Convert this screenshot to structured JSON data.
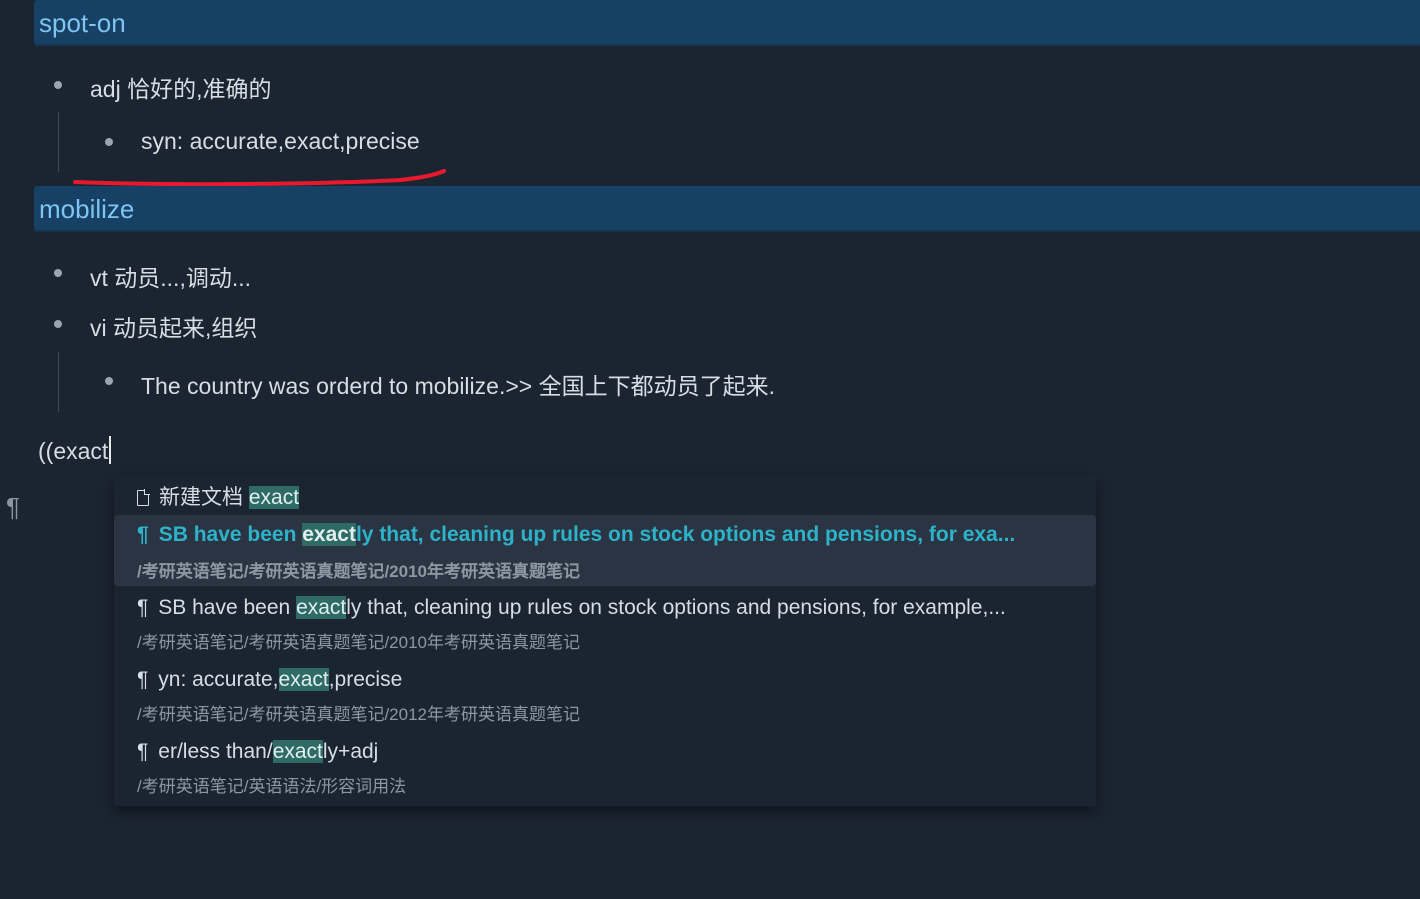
{
  "headings": {
    "h1": "spot-on",
    "h2": "mobilize"
  },
  "notes": {
    "adj": "adj 恰好的,准确的",
    "syn": "syn: accurate,exact,precise",
    "vt": "vt 动员...,调动...",
    "vi": "vi 动员起来,组织",
    "example": "The country was orderd to mobilize.>> 全国上下都动员了起来."
  },
  "input": {
    "typed": "((exact"
  },
  "margin": {
    "pilcrow": "¶"
  },
  "popup": {
    "new_doc": {
      "label": "新建文档 ",
      "highlight": "exact"
    },
    "results": [
      {
        "icon": "¶",
        "pre": "SB have been ",
        "hl": "exact",
        "post": "ly that, cleaning up rules on stock options and pensions, for exa...",
        "path": "/考研英语笔记/考研英语真题笔记/2010年考研英语真题笔记"
      },
      {
        "icon": "¶",
        "pre": "SB have been ",
        "hl": "exact",
        "post": "ly that, cleaning up rules on stock options and pensions, for example,...",
        "path": "/考研英语笔记/考研英语真题笔记/2010年考研英语真题笔记"
      },
      {
        "icon": "¶",
        "pre": "yn: accurate,",
        "hl": "exact",
        "post": ",precise",
        "path": "/考研英语笔记/考研英语真题笔记/2012年考研英语真题笔记"
      },
      {
        "icon": "¶",
        "pre": "er/less than/",
        "hl": "exact",
        "post": "ly+adj",
        "path": "/考研英语笔记/英语语法/形容词用法"
      }
    ]
  },
  "colors": {
    "background": "#1b2532",
    "heading_bg": "#164064",
    "heading_text": "#7fc4f2",
    "active_text": "#2cb3c9",
    "highlight_bg": "#2d6b64",
    "annotation_red": "#e8192c"
  }
}
